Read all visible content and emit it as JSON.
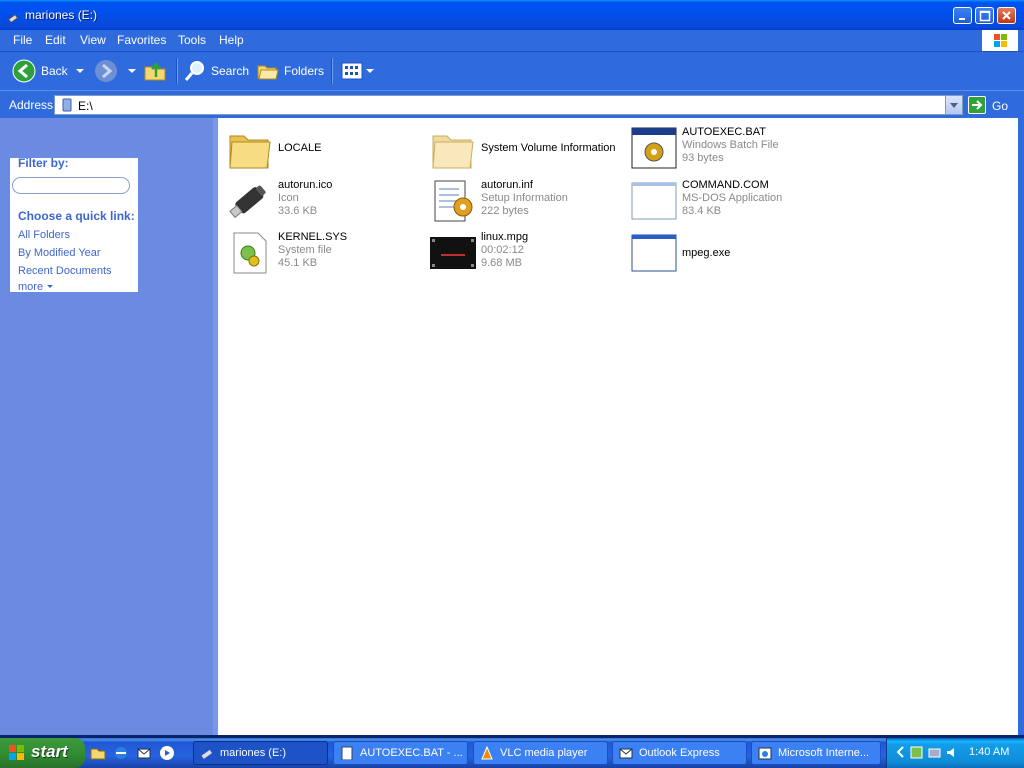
{
  "window": {
    "title": "mariones (E:)"
  },
  "menu": {
    "items": [
      "File",
      "Edit",
      "View",
      "Favorites",
      "Tools",
      "Help"
    ]
  },
  "toolbar": {
    "back": "Back",
    "search": "Search",
    "folders": "Folders"
  },
  "address": {
    "label": "Address",
    "value": "E:\\",
    "go": "Go"
  },
  "filter": {
    "heading": "Filter by:",
    "input_value": "",
    "quick_heading": "Choose a quick link:",
    "links": [
      "All Folders",
      "By Modified Year",
      "Recent Documents",
      "more"
    ]
  },
  "files": [
    {
      "name": "LOCALE",
      "line2": "",
      "line3": "",
      "icon": "folder-icon"
    },
    {
      "name": "System Volume Information",
      "line2": "",
      "line3": "",
      "icon": "folder-icon"
    },
    {
      "name": "AUTOEXEC.BAT",
      "line2": "Windows Batch File",
      "line3": "93 bytes",
      "icon": "batch-file-icon"
    },
    {
      "name": "autorun.ico",
      "line2": "Icon",
      "line3": "33.6 KB",
      "icon": "usb-drive-icon"
    },
    {
      "name": "autorun.inf",
      "line2": "Setup Information",
      "line3": "222 bytes",
      "icon": "setup-info-icon"
    },
    {
      "name": "COMMAND.COM",
      "line2": "MS-DOS Application",
      "line3": "83.4 KB",
      "icon": "dos-app-icon"
    },
    {
      "name": "KERNEL.SYS",
      "line2": "System file",
      "line3": "45.1 KB",
      "icon": "system-file-icon"
    },
    {
      "name": "linux.mpg",
      "line2": "00:02:12",
      "line3": "9.68 MB",
      "icon": "video-file-icon"
    },
    {
      "name": "mpeg.exe",
      "line2": "",
      "line3": "",
      "icon": "exe-app-icon"
    }
  ],
  "taskbar": {
    "start": "start",
    "buttons": [
      "mariones (E:)",
      "AUTOEXEC.BAT - ...",
      "VLC media player",
      "Outlook Express",
      "Microsoft Interne..."
    ],
    "clock": "1:40 AM"
  },
  "colors": {
    "accent": "#2f6bdd",
    "left_pane": "#6b8ae2",
    "link": "#3d66cf"
  }
}
